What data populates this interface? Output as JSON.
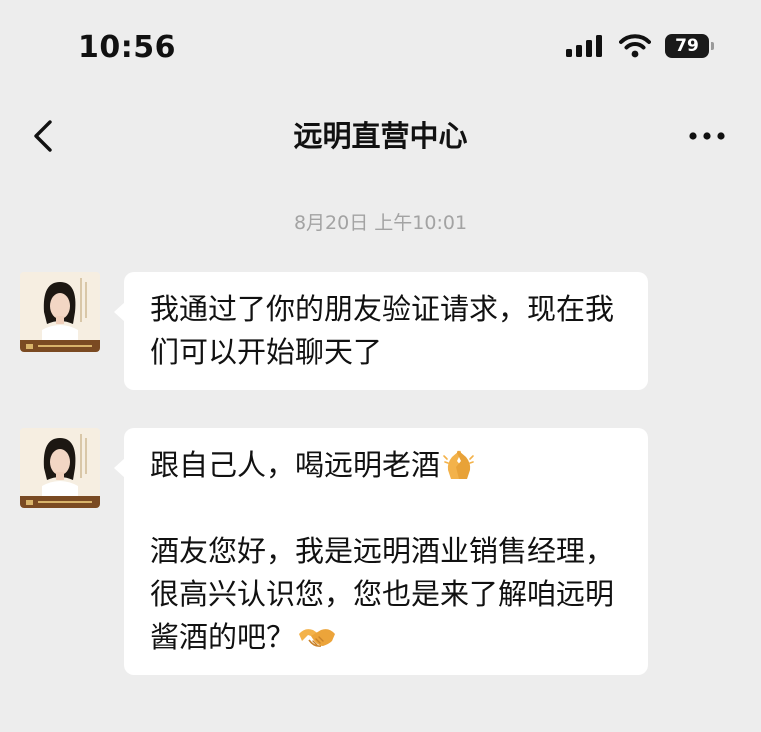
{
  "status_bar": {
    "time": "10:56",
    "battery": "79",
    "signal_icon": "cellular-signal-icon",
    "wifi_icon": "wifi-icon"
  },
  "nav": {
    "title": "远明直营中心",
    "back_icon": "chevron-left-icon",
    "more_icon": "more-icon"
  },
  "chat": {
    "timestamp": "8月20日 上午10:01",
    "messages": [
      {
        "sender": "远明直营中心",
        "avatar_icon": "person-avatar",
        "lines": [
          "我通过了你的朋友验证请求，现在我们可以开始聊天了"
        ]
      },
      {
        "sender": "远明直营中心",
        "avatar_icon": "person-avatar",
        "line1": "跟自己人，喝远明老酒",
        "line1_emoji": "folded-hands-icon",
        "line2": "酒友您好，我是远明酒业销售经理，很高兴认识您，您也是来了解咱远明酱酒的吧？",
        "line2_emoji": "handshake-icon"
      }
    ]
  },
  "colors": {
    "background": "#ededed",
    "bubble": "#ffffff",
    "timestamp": "#a3a3a3",
    "avatar_band": "#7a4a22"
  }
}
